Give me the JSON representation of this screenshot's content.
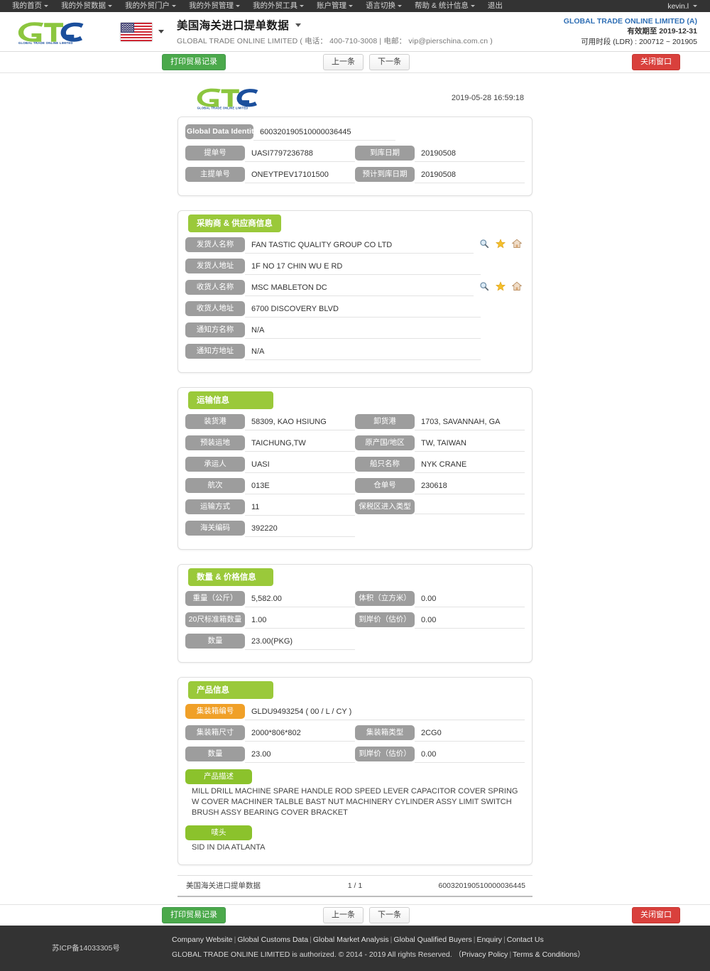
{
  "topnav": {
    "items": [
      {
        "label": "我的首页",
        "caret": true
      },
      {
        "label": "我的外贸数据",
        "caret": true
      },
      {
        "label": "我的外贸门户",
        "caret": true
      },
      {
        "label": "我的外贸管理",
        "caret": true
      },
      {
        "label": "我的外贸工具",
        "caret": true
      },
      {
        "label": "账户管理",
        "caret": true
      },
      {
        "label": "语言切换",
        "caret": true
      },
      {
        "label": "帮助 & 统计信息",
        "caret": true
      },
      {
        "label": "退出",
        "caret": false
      }
    ],
    "user": "kevin.l"
  },
  "header": {
    "logo_text": "GLOBAL TRADE ONLINE LIMITED",
    "flag": "us-flag-icon",
    "page_title": "美国海关进口提单数据",
    "company_line": "GLOBAL TRADE ONLINE LIMITED ( 电话： 400-710-3008 | 电邮： vip@pierschina.com.cn )",
    "account_name": "GLOBAL TRADE ONLINE LIMITED (A)",
    "account_expiry": "有效期至 2019-12-31",
    "account_ldr": "可用时段 (LDR) : 200712 ~ 201905"
  },
  "toolbar": {
    "print_label": "打印贸易记录",
    "prev_label": "上一条",
    "next_label": "下一条",
    "close_label": "关闭窗口"
  },
  "sheet": {
    "timestamp": "2019-05-28 16:59:18",
    "identity": {
      "label": "Global Data Identity",
      "value": "600320190510000036445"
    },
    "basic": [
      {
        "label": "提单号",
        "value": "UASI7797236788"
      },
      {
        "label": "到库日期",
        "value": "20190508"
      },
      {
        "label": "主提单号",
        "value": "ONEYTPEV17101500"
      },
      {
        "label": "预计到库日期",
        "value": "20190508"
      }
    ],
    "supplier": {
      "title": "采购商 & 供应商信息",
      "rows": [
        {
          "label": "发货人名称",
          "value": "FAN TASTIC QUALITY GROUP CO LTD",
          "icons": true
        },
        {
          "label": "发货人地址",
          "value": "1F NO 17 CHIN WU E RD",
          "icons": false
        },
        {
          "label": "收货人名称",
          "value": "MSC MABLETON DC",
          "icons": true
        },
        {
          "label": "收货人地址",
          "value": "6700 DISCOVERY BLVD",
          "icons": false
        },
        {
          "label": "通知方名称",
          "value": "N/A",
          "icons": false
        },
        {
          "label": "通知方地址",
          "value": "N/A",
          "icons": false
        }
      ]
    },
    "transport": {
      "title": "运输信息",
      "rows": [
        [
          {
            "label": "装货港",
            "value": "58309, KAO HSIUNG"
          },
          {
            "label": "卸货港",
            "value": "1703, SAVANNAH, GA"
          }
        ],
        [
          {
            "label": "预装运地",
            "value": "TAICHUNG,TW"
          },
          {
            "label": "原产国/地区",
            "value": "TW, TAIWAN"
          }
        ],
        [
          {
            "label": "承运人",
            "value": "UASI"
          },
          {
            "label": "船只名称",
            "value": "NYK CRANE"
          }
        ],
        [
          {
            "label": "航次",
            "value": "013E"
          },
          {
            "label": "仓单号",
            "value": "230618"
          }
        ],
        [
          {
            "label": "运输方式",
            "value": "11"
          },
          {
            "label": "保税区进入类型",
            "value": ""
          }
        ],
        [
          {
            "label": "海关编码",
            "value": "392220"
          },
          null
        ]
      ]
    },
    "quantity": {
      "title": "数量 & 价格信息",
      "rows": [
        [
          {
            "label": "重量（公斤）",
            "value": "5,582.00"
          },
          {
            "label": "体积（立方米）",
            "value": "0.00"
          }
        ],
        [
          {
            "label": "20尺标准箱数量",
            "value": "1.00"
          },
          {
            "label": "到岸价（估价）",
            "value": "0.00"
          }
        ],
        [
          {
            "label": "数量",
            "value": "23.00(PKG)"
          },
          null
        ]
      ]
    },
    "product": {
      "title": "产品信息",
      "container_no": {
        "label": "集装箱编号",
        "value": "GLDU9493254 ( 00 / L / CY )"
      },
      "rows": [
        [
          {
            "label": "集装箱尺寸",
            "value": "2000*806*802"
          },
          {
            "label": "集装箱类型",
            "value": "2CG0"
          }
        ],
        [
          {
            "label": "数量",
            "value": "23.00"
          },
          {
            "label": "到岸价（估价）",
            "value": "0.00"
          }
        ]
      ],
      "desc_label": "产品描述",
      "desc_value": "MILL DRILL MACHINE SPARE HANDLE ROD SPEED LEVER CAPACITOR COVER SPRING W COVER MACHINER TALBLE BAST NUT MACHINERY CYLINDER ASSY LIMIT SWITCH BRUSH ASSY BEARING COVER BRACKET",
      "mark_label": "唛头",
      "mark_value": "SID IN DIA ATLANTA"
    },
    "footer": {
      "left": "美国海关进口提单数据",
      "page": "1 / 1",
      "right": "600320190510000036445"
    }
  },
  "footer": {
    "icp": "苏ICP备14033305号",
    "links": [
      "Company Website",
      "Global Customs Data",
      "Global Market Analysis",
      "Global Qualified Buyers",
      "Enquiry",
      "Contact Us"
    ],
    "copyright": "GLOBAL TRADE ONLINE LIMITED is authorized. © 2014 - 2019 All rights Reserved.",
    "legal_open": "（",
    "legal_links": [
      "Privacy Policy",
      "Terms & Conditions"
    ],
    "legal_close": "）"
  }
}
